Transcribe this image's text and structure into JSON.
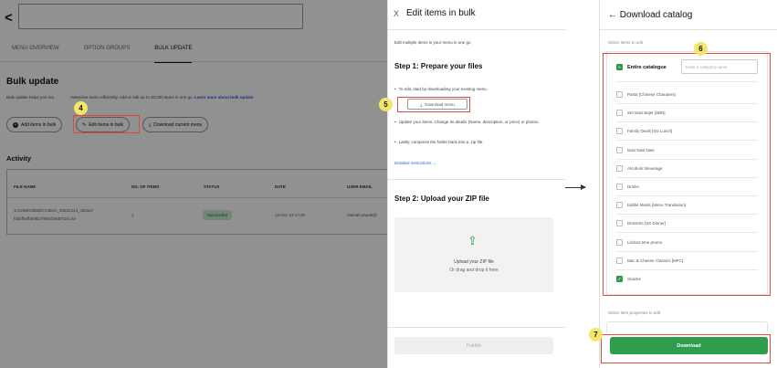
{
  "left": {
    "tabs": [
      "MENU OVERVIEW",
      "OPTION GROUPS",
      "BULK UPDATE"
    ],
    "title": "Bulk update",
    "desc_pre": "Bulk update helps you ma",
    "desc_post": "extensive menu efficiently. Add or edit up to 20,000 items in one go.",
    "desc_link": "Learn more about bulk update",
    "buttons": {
      "add": "Add items in bulk",
      "edit": "Edit items in bulk",
      "download": "Download current menu"
    },
    "activity_title": "Activity",
    "table": {
      "headers": [
        "FILE NAME",
        "NO. OF ITEMS",
        "STATUS",
        "DATE",
        "USER EMAIL"
      ],
      "row": {
        "file_1": "1-C2WECBMDCC4EJA_20231213_c52aa7",
        "file_2": "f4bbfb4fb59bb7f89bd40d0710.csv",
        "items": "1",
        "status": "Successful",
        "date": "13 Dec 23 17:26",
        "email": "nalmah.sauab@"
      }
    }
  },
  "middle": {
    "close": "X",
    "title": "Edit items in bulk",
    "subtitle": "Edit multiple items in your menu in one go",
    "step1": "Step 1: Prepare your files",
    "bullet1": "To edit, start by downloading your existing menu.",
    "download_btn": "Download menu",
    "bullet2": "Update your items. Change its details (Name, description, or price) or photos.",
    "bullet3": "Lastly, compress the folder back into a .zip file.",
    "detailed": "Detailed instructions →",
    "step2": "Step 2: Upload your ZIP file",
    "upload_title": "Upload your ZIP file",
    "upload_sub": "Or drag and drop it here",
    "publish": "Publish"
  },
  "right": {
    "title": "← Download catalog",
    "select_label": "Select items to edit",
    "entire": "Entire catalogue",
    "search_placeholder": "Enter a category name",
    "categories": [
      {
        "name": "Pasta [Chinese Charaters]",
        "checked": false
      },
      {
        "name": "Set Nasi Bajet [SBN]",
        "checked": false
      },
      {
        "name": "Family Deals [SS Lunch]",
        "checked": false
      },
      {
        "name": "Nasi Nasi Nasi",
        "checked": false
      },
      {
        "name": "Alcoholic Beverage",
        "checked": false
      },
      {
        "name": "Drinks",
        "checked": false
      },
      {
        "name": "Kiddie Meals [Menu Translation]",
        "checked": false
      },
      {
        "name": "Desserts [SS Dinner]",
        "checked": false
      },
      {
        "name": "Limited time promo",
        "checked": false
      },
      {
        "name": "Mac & Cheese Classics [MFC]",
        "checked": false
      },
      {
        "name": "Snacks",
        "checked": true
      }
    ],
    "props_label": "Select item properties to edit",
    "download": "Download"
  },
  "markers": {
    "m4": "4",
    "m5": "5",
    "m6": "6",
    "m7": "7"
  },
  "colors": {
    "accent": "#2e9e4c",
    "marker": "#f4e66a",
    "highlight": "#e04a3a"
  }
}
